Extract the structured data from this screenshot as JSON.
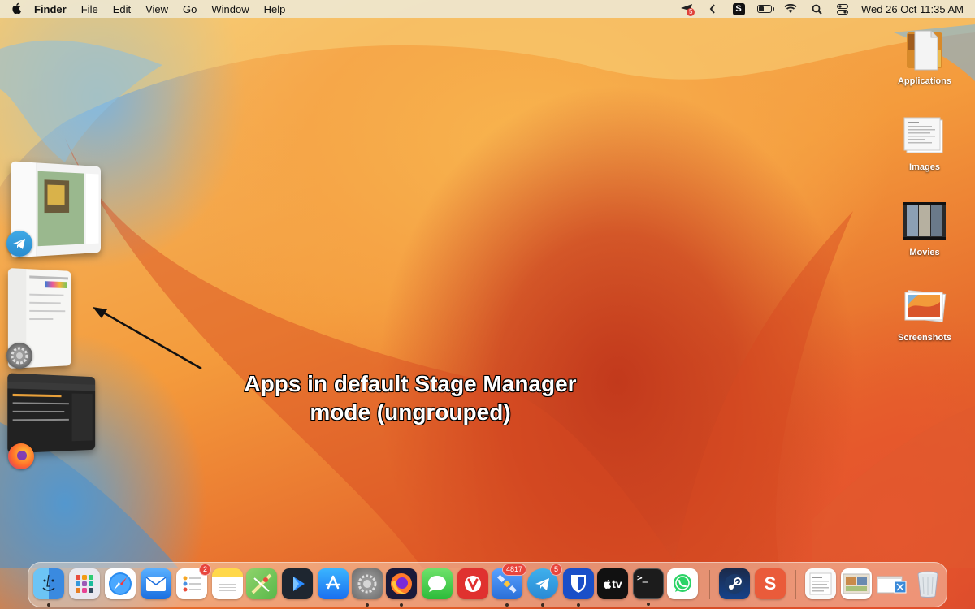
{
  "menubar": {
    "apple_icon": "apple-logo-icon",
    "app_name": "Finder",
    "menus": [
      "File",
      "Edit",
      "View",
      "Go",
      "Window",
      "Help"
    ],
    "status": {
      "notification_badge": "5",
      "s_app_letter": "S",
      "clock": "Wed 26 Oct  11:35 AM"
    }
  },
  "desktop_icons": [
    {
      "label": "Applications",
      "icon": "document-folder-icon"
    },
    {
      "label": "Images",
      "icon": "images-folder-icon"
    },
    {
      "label": "Movies",
      "icon": "movies-folder-icon"
    },
    {
      "label": "Screenshots",
      "icon": "screenshots-folder-icon"
    }
  ],
  "annotation": {
    "line1": "Apps in default Stage Manager",
    "line2": "mode (ungrouped)"
  },
  "stage_manager": [
    {
      "app": "Telegram",
      "icon": "telegram-icon"
    },
    {
      "app": "System Settings",
      "icon": "system-settings-icon"
    },
    {
      "app": "Firefox",
      "icon": "firefox-icon"
    }
  ],
  "dock": {
    "items": [
      {
        "name": "Finder",
        "icon": "finder-icon",
        "running": true
      },
      {
        "name": "Launchpad",
        "icon": "launchpad-icon",
        "running": false
      },
      {
        "name": "Safari",
        "icon": "safari-icon",
        "running": false
      },
      {
        "name": "Mail",
        "icon": "mail-icon",
        "running": false
      },
      {
        "name": "Reminders",
        "icon": "reminders-icon",
        "running": false,
        "badge": "2"
      },
      {
        "name": "Notes",
        "icon": "notes-icon",
        "running": false
      },
      {
        "name": "Maps",
        "icon": "maps-icon",
        "running": false
      },
      {
        "name": "Infuse",
        "icon": "play-icon",
        "running": false
      },
      {
        "name": "App Store",
        "icon": "app-store-icon",
        "running": false
      },
      {
        "name": "System Settings",
        "icon": "system-settings-icon",
        "running": true
      },
      {
        "name": "Firefox",
        "icon": "firefox-icon",
        "running": true
      },
      {
        "name": "Messages",
        "icon": "messages-icon",
        "running": false
      },
      {
        "name": "Vivaldi",
        "icon": "vivaldi-icon",
        "running": false
      },
      {
        "name": "NetNewsWire",
        "icon": "satellite-icon",
        "running": true,
        "badge": "4817"
      },
      {
        "name": "Telegram",
        "icon": "telegram-icon",
        "running": true,
        "badge": "5"
      },
      {
        "name": "Bitwarden",
        "icon": "bitwarden-icon",
        "running": true
      },
      {
        "name": "Apple TV",
        "icon": "apple-tv-icon",
        "running": false,
        "text": "tv"
      },
      {
        "name": "Terminal",
        "icon": "terminal-icon",
        "running": true,
        "text": ">_"
      },
      {
        "name": "WhatsApp",
        "icon": "whatsapp-icon",
        "running": false
      },
      {
        "name": "Steam",
        "icon": "steam-icon",
        "running": false
      },
      {
        "name": "Simplenote",
        "icon": "s-app-icon",
        "running": false,
        "text": "S"
      },
      {
        "name": "Downloads stack",
        "icon": "documents-stack-icon",
        "running": false
      },
      {
        "name": "Screenshots stack",
        "icon": "screenshots-stack-icon",
        "running": false
      },
      {
        "name": "Recent stack",
        "icon": "window-stack-icon",
        "running": false
      },
      {
        "name": "Trash",
        "icon": "trash-icon",
        "running": false
      }
    ]
  },
  "colors": {
    "menubar_bg": "#eee8d4",
    "badge_red": "#e8453c"
  }
}
